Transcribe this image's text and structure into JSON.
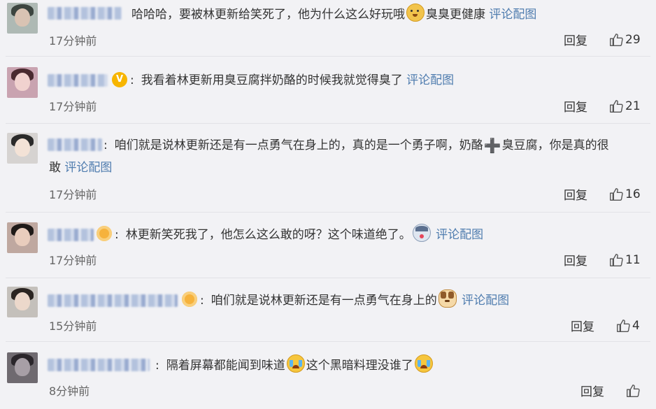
{
  "comments": [
    {
      "text": "哈哈哈，要被林更新给笑死了，他为什么这么好玩哦",
      "emoji": "doge-emoji",
      "after_emoji": "臭臭更健康",
      "link": "评论配图",
      "time": "17分钟前",
      "reply": "回复",
      "likes": "29"
    },
    {
      "badge": "V",
      "text": "我看着林更新用臭豆腐拌奶酪的时候我就觉得臭了",
      "link": "评论配图",
      "time": "17分钟前",
      "reply": "回复",
      "likes": "21"
    },
    {
      "text_line1_a": "咱们就是说林更新还是有一点勇气在身上的，真的是一个勇子啊，奶酪",
      "plus": "➕",
      "text_line1_b": "臭豆腐，你是真的很",
      "text_line2": "敢",
      "link": "评论配图",
      "time": "17分钟前",
      "reply": "回复",
      "likes": "16"
    },
    {
      "text": "林更新笑死我了，他怎么这么敢的呀？这个味道绝了。",
      "emoji": "husky-emoji",
      "link": "评论配图",
      "time": "17分钟前",
      "reply": "回复",
      "likes": "11"
    },
    {
      "text": "咱们就是说林更新还是有一点勇气在身上的",
      "emoji": "cat-emoji",
      "link": "评论配图",
      "time": "15分钟前",
      "reply": "回复",
      "likes": "4"
    },
    {
      "text_a": "隔着屏幕都能闻到味道",
      "emoji": "crying-laugh-emoji",
      "text_b": "这个黑暗料理没谁了",
      "time": "8分钟前",
      "reply": "回复",
      "likes": ""
    }
  ],
  "colors": {
    "background": "#f2f2f5",
    "link": "#507daf",
    "text": "#333333",
    "muted": "#666666"
  }
}
